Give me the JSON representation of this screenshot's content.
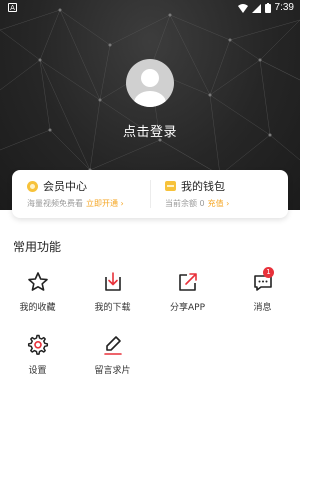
{
  "status_bar": {
    "time": "7:39",
    "left_icon": "A"
  },
  "profile": {
    "avatar_icon": "default-avatar-icon",
    "login_label": "点击登录"
  },
  "card": {
    "vip": {
      "icon": "coin-icon",
      "title": "会员中心",
      "subtitle": "海量视频免费看",
      "action": "立即开通 ›"
    },
    "wallet": {
      "icon": "wallet-icon",
      "title": "我的钱包",
      "subtitle": "当前余额 0",
      "action": "充值 ›"
    },
    "accent_color": "#f5a623"
  },
  "functions": {
    "title": "常用功能",
    "items": [
      {
        "label": "我的收藏",
        "icon": "star-icon"
      },
      {
        "label": "我的下载",
        "icon": "download-icon"
      },
      {
        "label": "分享APP",
        "icon": "share-icon"
      },
      {
        "label": "消息",
        "icon": "message-icon",
        "badge": "1"
      },
      {
        "label": "设置",
        "icon": "gear-icon"
      },
      {
        "label": "留言求片",
        "icon": "edit-icon"
      }
    ],
    "badge_color": "#e8313a"
  }
}
